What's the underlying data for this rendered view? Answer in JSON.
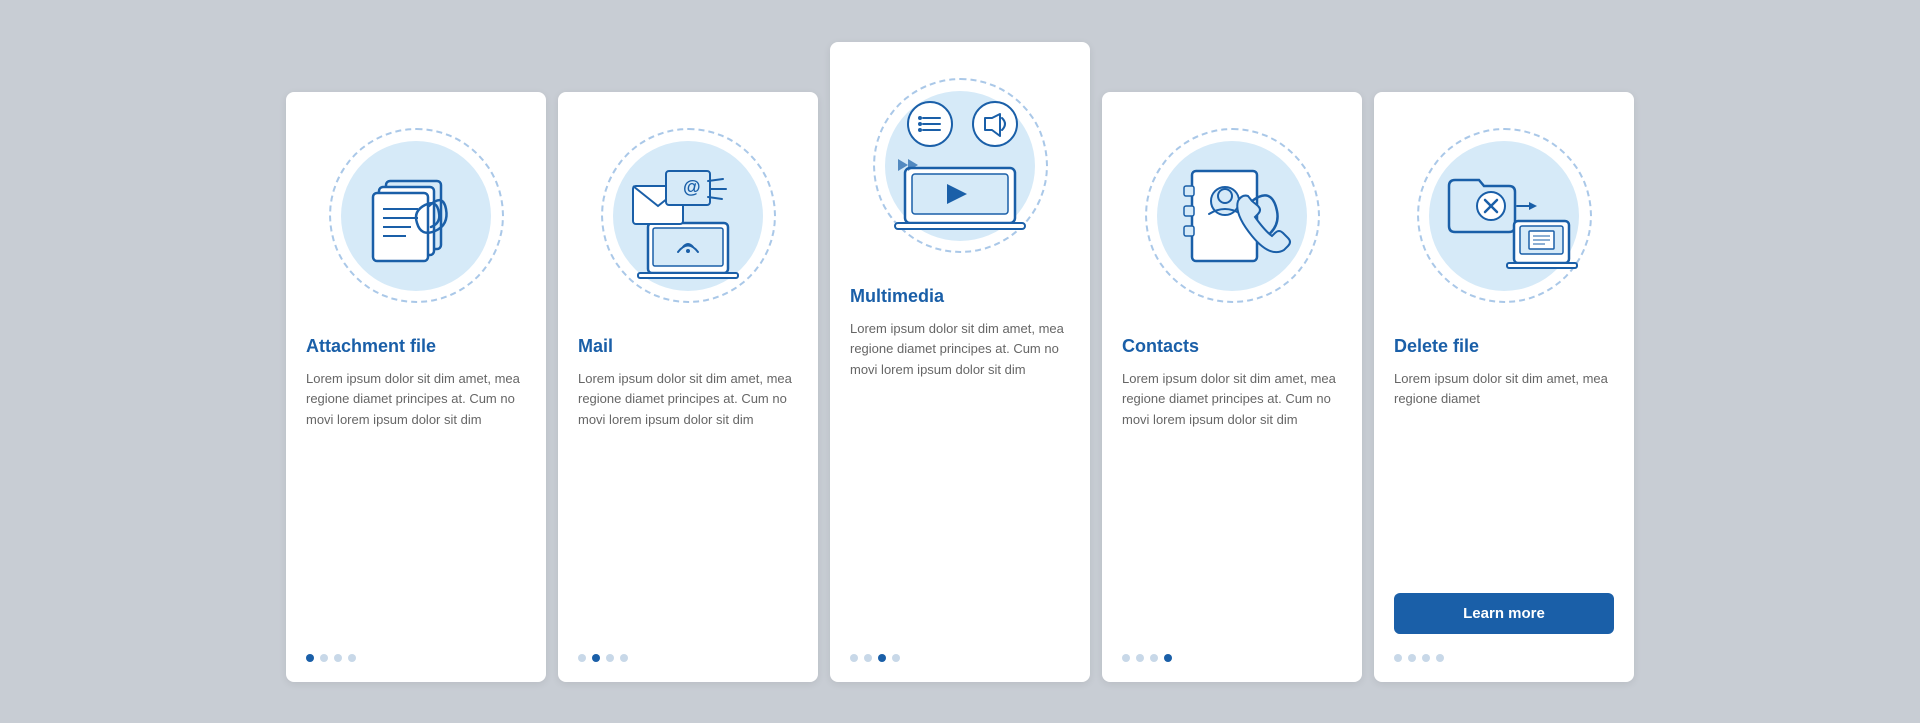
{
  "cards": [
    {
      "id": "attachment-file",
      "title": "Attachment file",
      "text": "Lorem ipsum dolor sit dim amet, mea regione diamet principes at. Cum no movi lorem ipsum dolor sit dim",
      "dots": [
        true,
        false,
        false,
        false
      ],
      "active": false,
      "show_button": false,
      "button_label": ""
    },
    {
      "id": "mail",
      "title": "Mail",
      "text": "Lorem ipsum dolor sit dim amet, mea regione diamet principes at. Cum no movi lorem ipsum dolor sit dim",
      "dots": [
        false,
        true,
        false,
        false
      ],
      "active": false,
      "show_button": false,
      "button_label": ""
    },
    {
      "id": "multimedia",
      "title": "Multimedia",
      "text": "Lorem ipsum dolor sit dim amet, mea regione diamet principes at. Cum no movi lorem ipsum dolor sit dim",
      "dots": [
        false,
        false,
        true,
        false
      ],
      "active": true,
      "show_button": false,
      "button_label": ""
    },
    {
      "id": "contacts",
      "title": "Contacts",
      "text": "Lorem ipsum dolor sit dim amet, mea regione diamet principes at. Cum no movi lorem ipsum dolor sit dim",
      "dots": [
        false,
        false,
        false,
        true
      ],
      "active": false,
      "show_button": false,
      "button_label": ""
    },
    {
      "id": "delete-file",
      "title": "Delete file",
      "text": "Lorem ipsum dolor sit dim amet, mea regione diamet",
      "dots": [
        false,
        false,
        false,
        false
      ],
      "active": false,
      "show_button": true,
      "button_label": "Learn more"
    }
  ],
  "colors": {
    "accent": "#1a5fa8",
    "circle_bg": "#d6eaf8",
    "dot_inactive": "#c8d8e8",
    "dot_active": "#1a5fa8"
  }
}
